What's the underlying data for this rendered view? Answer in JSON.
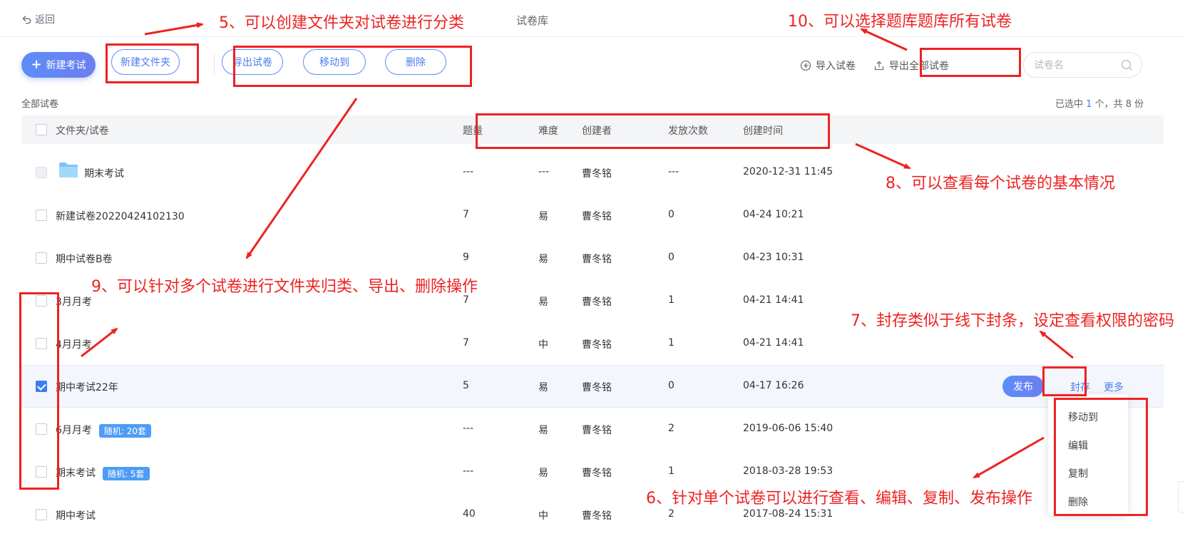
{
  "header": {
    "back_label": "返回",
    "title": "试卷库"
  },
  "toolbar": {
    "new_exam": "新建考试",
    "new_folder": "新建文件夹",
    "export_papers": "导出试卷",
    "move_to": "移动到",
    "delete": "删除",
    "import_papers": "导入试卷",
    "export_all": "导出全部试卷",
    "search_placeholder": "试卷名"
  },
  "list": {
    "crumb": "全部试卷",
    "summary": {
      "prefix": "已选中",
      "selected": "1",
      "mid": "个，共",
      "total": "8",
      "suffix": "份"
    },
    "columns": {
      "name": "文件夹/试卷",
      "count": "题量",
      "difficulty": "难度",
      "creator": "创建者",
      "times": "发放次数",
      "created": "创建时间"
    },
    "rows": [
      {
        "name": "期末考试",
        "tag": "",
        "count": "---",
        "difficulty": "---",
        "creator": "曹冬铭",
        "times": "---",
        "created": "2020-12-31 11:45"
      },
      {
        "name": "新建试卷20220424102130",
        "tag": "",
        "count": "7",
        "difficulty": "易",
        "creator": "曹冬铭",
        "times": "0",
        "created": "04-24 10:21"
      },
      {
        "name": "期中试卷B卷",
        "tag": "",
        "count": "9",
        "difficulty": "易",
        "creator": "曹冬铭",
        "times": "0",
        "created": "04-23 10:31"
      },
      {
        "name": "3月月考",
        "tag": "",
        "count": "7",
        "difficulty": "易",
        "creator": "曹冬铭",
        "times": "1",
        "created": "04-21 14:41"
      },
      {
        "name": "4月月考",
        "tag": "",
        "count": "7",
        "difficulty": "中",
        "creator": "曹冬铭",
        "times": "1",
        "created": "04-21 14:41"
      },
      {
        "name": "期中考试22年",
        "tag": "",
        "count": "5",
        "difficulty": "易",
        "creator": "曹冬铭",
        "times": "0",
        "created": "04-17 16:26"
      },
      {
        "name": "6月月考",
        "tag": "随机: 20套",
        "count": "---",
        "difficulty": "易",
        "creator": "曹冬铭",
        "times": "2",
        "created": "2019-06-06 15:40"
      },
      {
        "name": "期末考试",
        "tag": "随机: 5套",
        "count": "---",
        "difficulty": "易",
        "creator": "曹冬铭",
        "times": "1",
        "created": "2018-03-28 19:53"
      },
      {
        "name": "期中考试",
        "tag": "",
        "count": "40",
        "difficulty": "中",
        "creator": "曹冬铭",
        "times": "2",
        "created": "2017-08-24 15:31"
      }
    ],
    "row_actions": {
      "publish": "发布",
      "seal": "封存",
      "more": "更多"
    }
  },
  "more_menu": [
    "移动到",
    "编辑",
    "复制",
    "删除"
  ],
  "annotations": {
    "a5": "5、可以创建文件夹对试卷进行分类",
    "a10": "10、可以选择题库题库所有试卷",
    "a8": "8、可以查看每个试卷的基本情况",
    "a9": "9、可以针对多个试卷进行文件夹归类、导出、删除操作",
    "a7": "7、封存类似于线下封条，设定查看权限的密码",
    "a6": "6、针对单个试卷可以进行查看、编辑、复制、发布操作"
  },
  "colors": {
    "accent": "#5b8ef7",
    "annotation": "#ee2222",
    "tag": "#4d9cf5"
  }
}
